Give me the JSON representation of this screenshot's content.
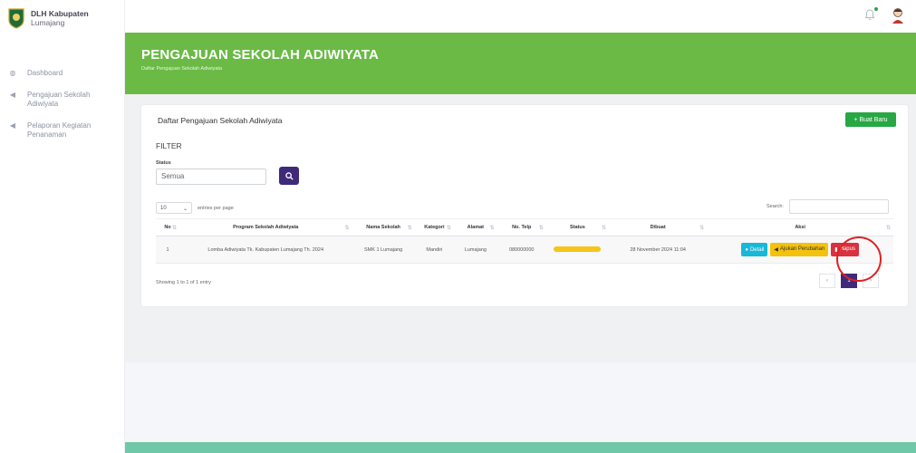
{
  "brand": {
    "line1": "DLH Kabupaten",
    "line2": "Lumajang"
  },
  "sidebar": {
    "items": [
      {
        "label": "Dashboard",
        "icon": "dashboard-icon"
      },
      {
        "label": "Pengajuan Sekolah Adiwiyata",
        "icon": "send-icon"
      },
      {
        "label": "Pelaporan Kegiatan Penanaman",
        "icon": "send-icon"
      }
    ]
  },
  "header": {
    "title": "PENGAJUAN SEKOLAH ADIWIYATA",
    "subtitle": "Daftar Pengajuan Sekolah Adiwiyata"
  },
  "card": {
    "title": "Daftar Pengajuan Sekolah Adiwiyata",
    "new_button": "+ Buat Baru",
    "filter_label": "FILTER",
    "status_label": "Status",
    "status_value": "Semua",
    "entries_value": "10",
    "entries_label": "entries per page",
    "search_label": "Search:"
  },
  "table": {
    "headers": [
      "No",
      "Program Sekolah Adiwiyata",
      "Nama Sekolah",
      "Kategori",
      "Alamat",
      "No. Telp",
      "Status",
      "Dibuat",
      "Aksi"
    ],
    "rows": [
      {
        "no": "1",
        "program": "Lomba Adiwiyata Tk. Kabupaten Lumajang Th. 2024",
        "sekolah": "SMK 1 Lumajang",
        "kategori": "Mandiri",
        "alamat": "Lumajang",
        "telp": "080000000",
        "dibuat": "28 November 2024 11:04",
        "btn_detail": "Detail",
        "btn_ajukan": "Ajukan Perubahan",
        "btn_hapus": "Hapus"
      }
    ]
  },
  "footer_info": "Showing 1 to 1 of 1 entry",
  "pager": {
    "prev": "‹",
    "current": "1",
    "next": "›"
  },
  "colors": {
    "green": "#6aba45",
    "primary": "#3f2a7a",
    "success": "#28a745",
    "info": "#17b8d8",
    "warning": "#f4c20d",
    "danger": "#d9313f"
  }
}
